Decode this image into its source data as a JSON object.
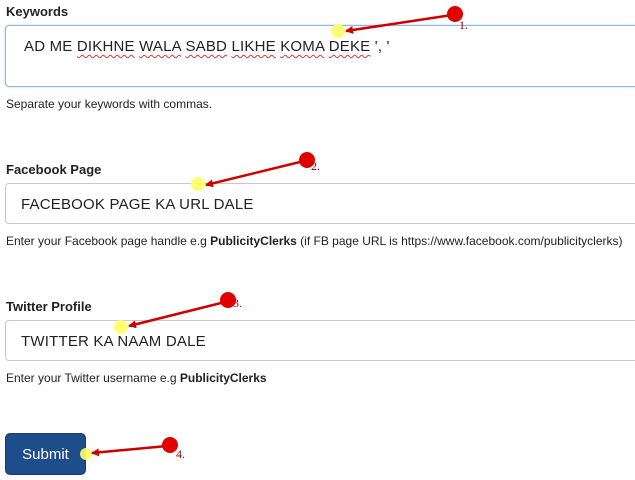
{
  "keywords": {
    "label": "Keywords",
    "value_parts": [
      "AD ME ",
      "DIKHNE",
      " ",
      "WALA",
      " ",
      "SABD",
      " ",
      "LIKHE",
      " ",
      "KOMA",
      " ",
      "DEKE",
      " ', '"
    ],
    "help": "Separate your keywords with commas."
  },
  "facebook": {
    "label": "Facebook Page",
    "value": "FACEBOOK PAGE KA URL DALE",
    "help_prefix": "Enter your Facebook page handle e.g ",
    "help_bold": "PublicityClerks",
    "help_suffix": " (if FB page URL is https://www.facebook.com/publicityclerks)"
  },
  "twitter": {
    "label": "Twitter Profile",
    "value": "TWITTER KA NAAM DALE",
    "help_prefix": "Enter your Twitter username e.g ",
    "help_bold": "PublicityClerks"
  },
  "submit_label": "Submit",
  "annotations": [
    "1.",
    "2.",
    "3.",
    "4."
  ],
  "colors": {
    "button": "#1e4d8c",
    "marker": "#e00000",
    "highlight": "#ffff66"
  }
}
